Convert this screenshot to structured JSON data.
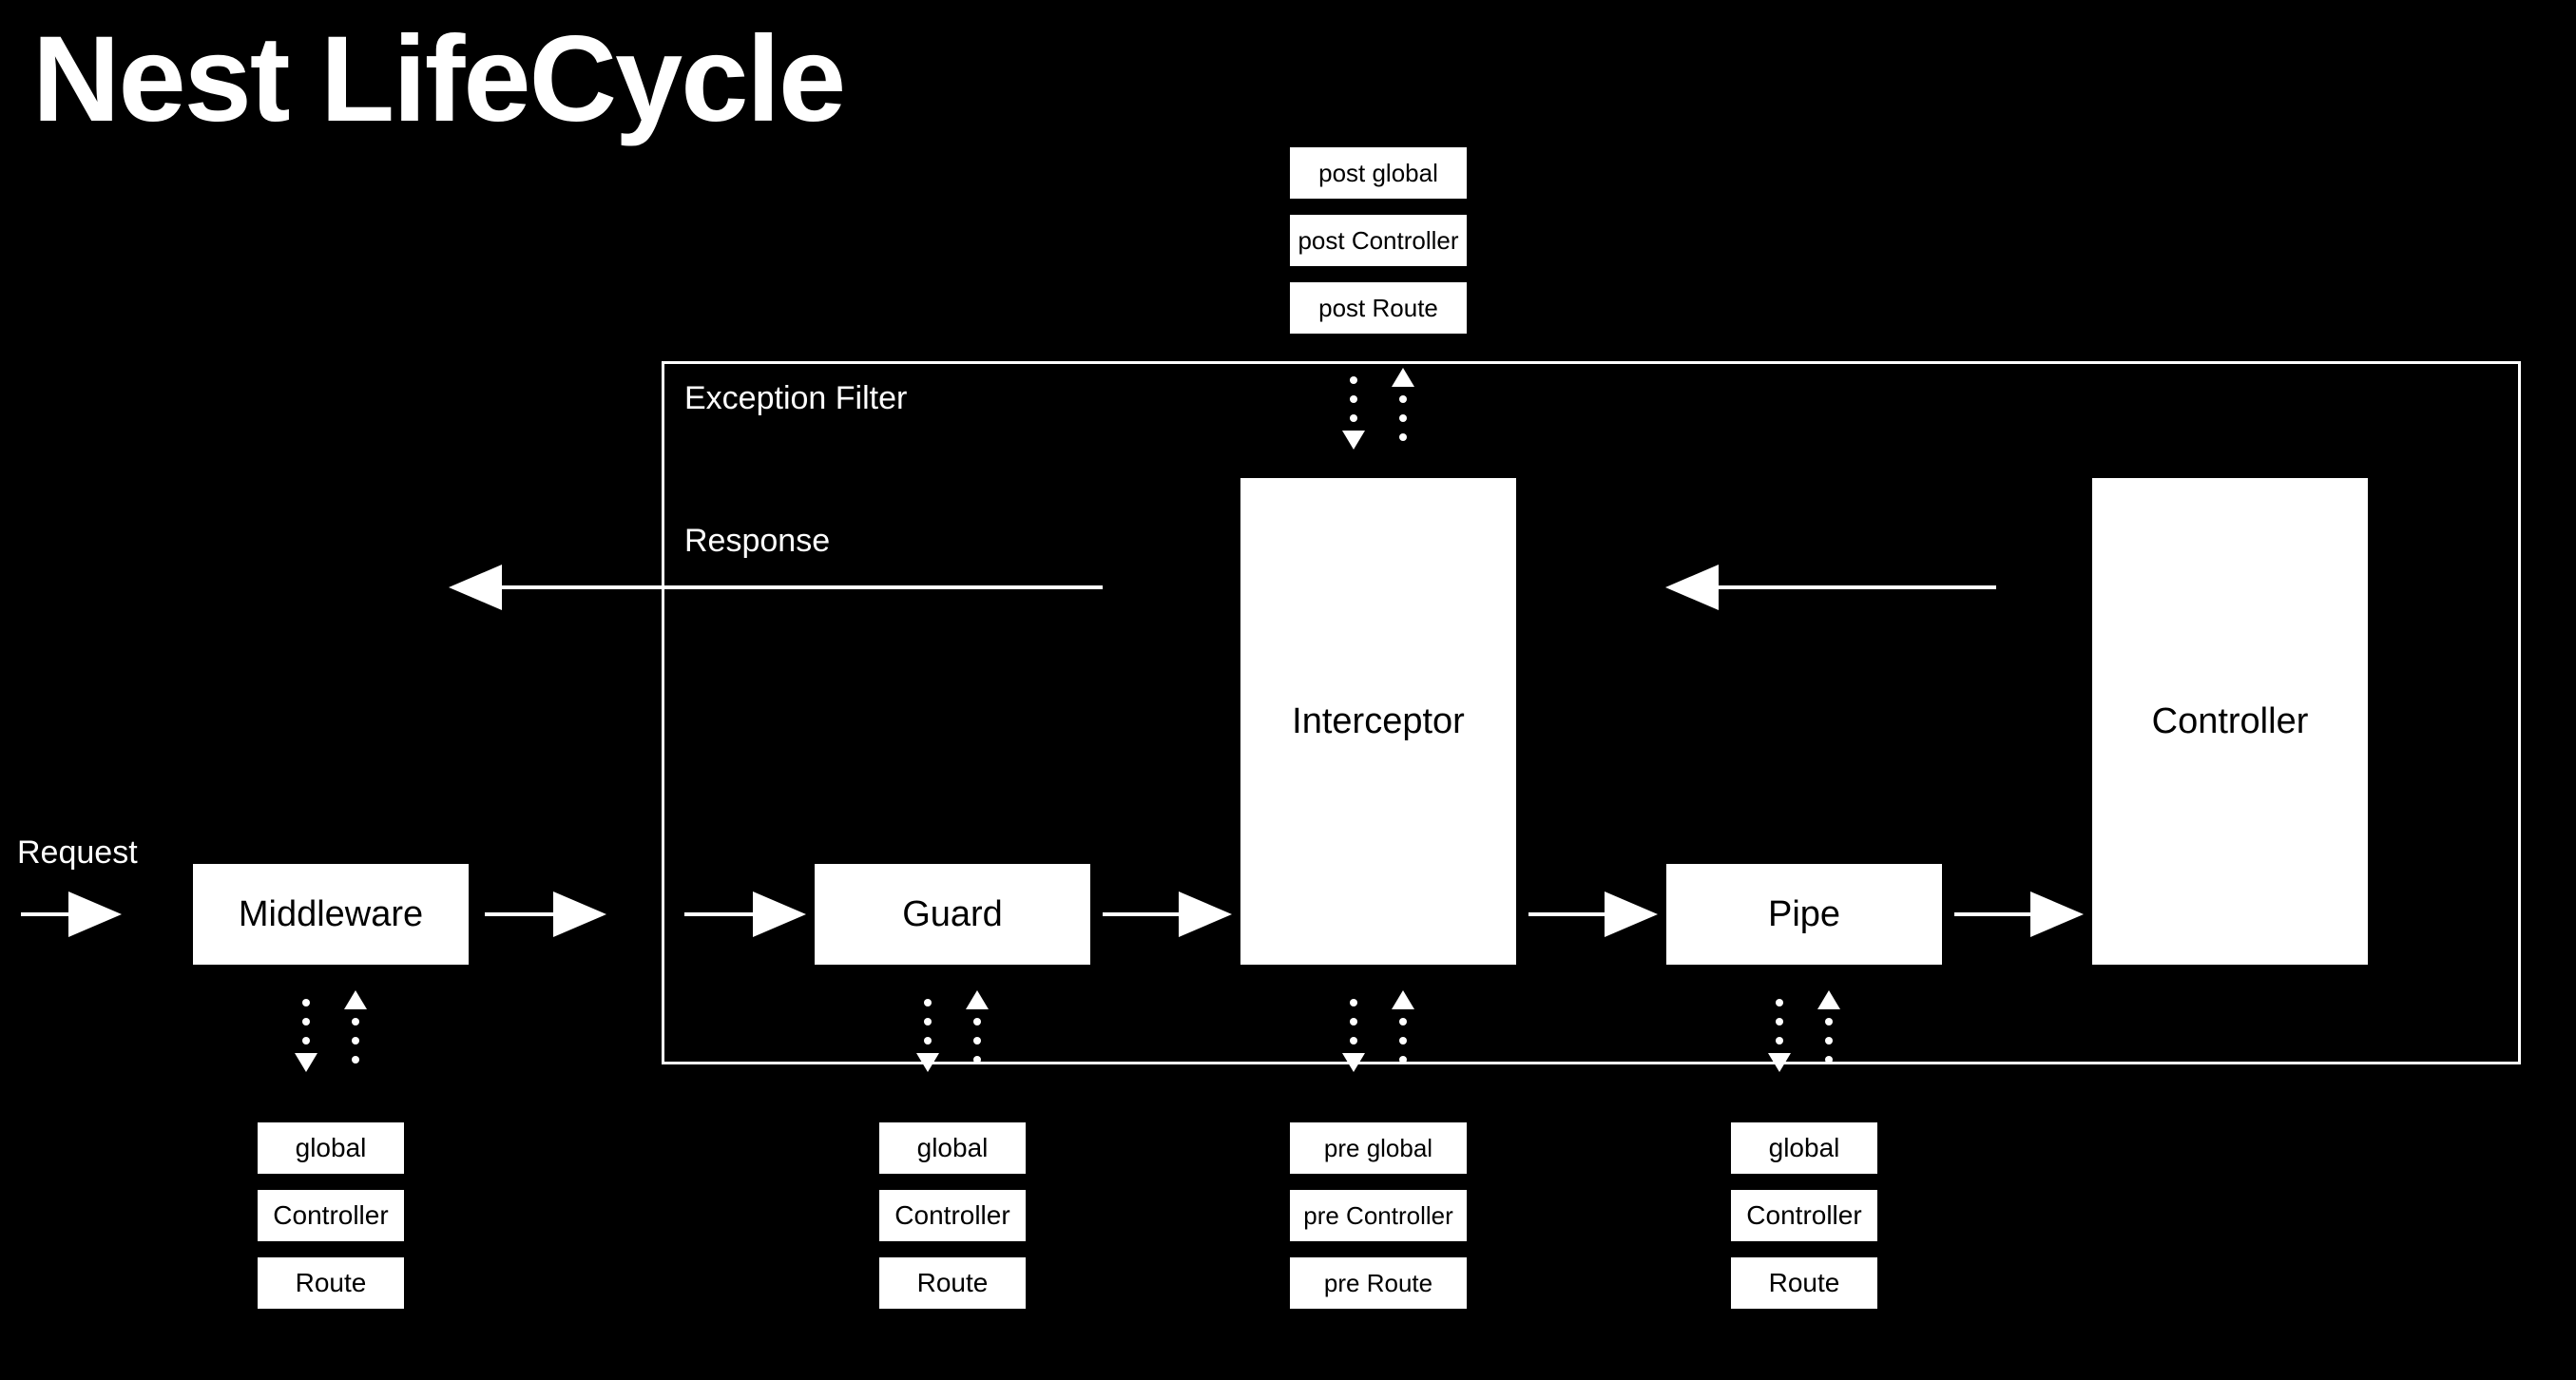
{
  "title": "Nest LifeCycle",
  "labels": {
    "request": "Request",
    "response": "Response",
    "exception_filter": "Exception Filter"
  },
  "boxes": {
    "middleware": "Middleware",
    "guard": "Guard",
    "interceptor": "Interceptor",
    "pipe": "Pipe",
    "controller": "Controller"
  },
  "sub": {
    "global": "global",
    "controller": "Controller",
    "route": "Route",
    "pre_global": "pre global",
    "pre_controller": "pre Controller",
    "pre_route": "pre Route",
    "post_global": "post global",
    "post_controller": "post Controller",
    "post_route": "post Route"
  },
  "colors": {
    "bg": "#000000",
    "fg": "#ffffff"
  }
}
